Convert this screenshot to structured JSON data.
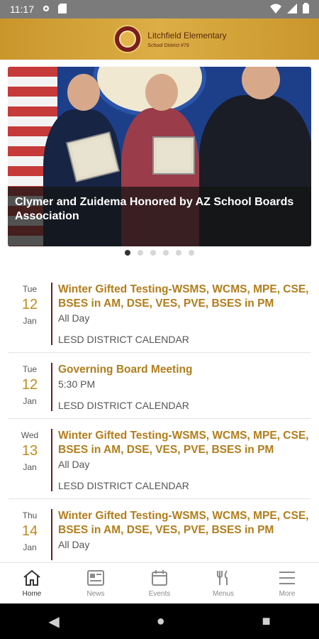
{
  "status": {
    "time": "11:17"
  },
  "header": {
    "school_name": "Litchfield Elementary",
    "district": "School District #79"
  },
  "hero": {
    "caption": "Clymer and Zuidema Honored by AZ School Boards Association",
    "slides": 6,
    "active_slide": 1
  },
  "events": [
    {
      "dow": "Tue",
      "day": "12",
      "month": "Jan",
      "title": "Winter Gifted Testing-WSMS, WCMS, MPE, CSE, BSES in AM, DSE, VES, PVE, BSES in PM",
      "time": "All Day",
      "calendar": "LESD DISTRICT CALENDAR"
    },
    {
      "dow": "Tue",
      "day": "12",
      "month": "Jan",
      "title": "Governing Board Meeting",
      "time": "5:30 PM",
      "calendar": "LESD DISTRICT CALENDAR"
    },
    {
      "dow": "Wed",
      "day": "13",
      "month": "Jan",
      "title": "Winter Gifted Testing-WSMS, WCMS, MPE, CSE, BSES in AM, DSE, VES, PVE, BSES in PM",
      "time": "All Day",
      "calendar": "LESD DISTRICT CALENDAR"
    },
    {
      "dow": "Thu",
      "day": "14",
      "month": "Jan",
      "title": "Winter Gifted Testing-WSMS, WCMS, MPE, CSE, BSES in AM, DSE, VES, PVE, BSES in PM",
      "time": "All Day",
      "calendar": ""
    }
  ],
  "nav": {
    "home": "Home",
    "news": "News",
    "events": "Events",
    "menus": "Menus",
    "more": "More"
  },
  "colors": {
    "accent": "#c9962c",
    "title": "#b27d1b",
    "maroon": "#6b1e1e"
  }
}
